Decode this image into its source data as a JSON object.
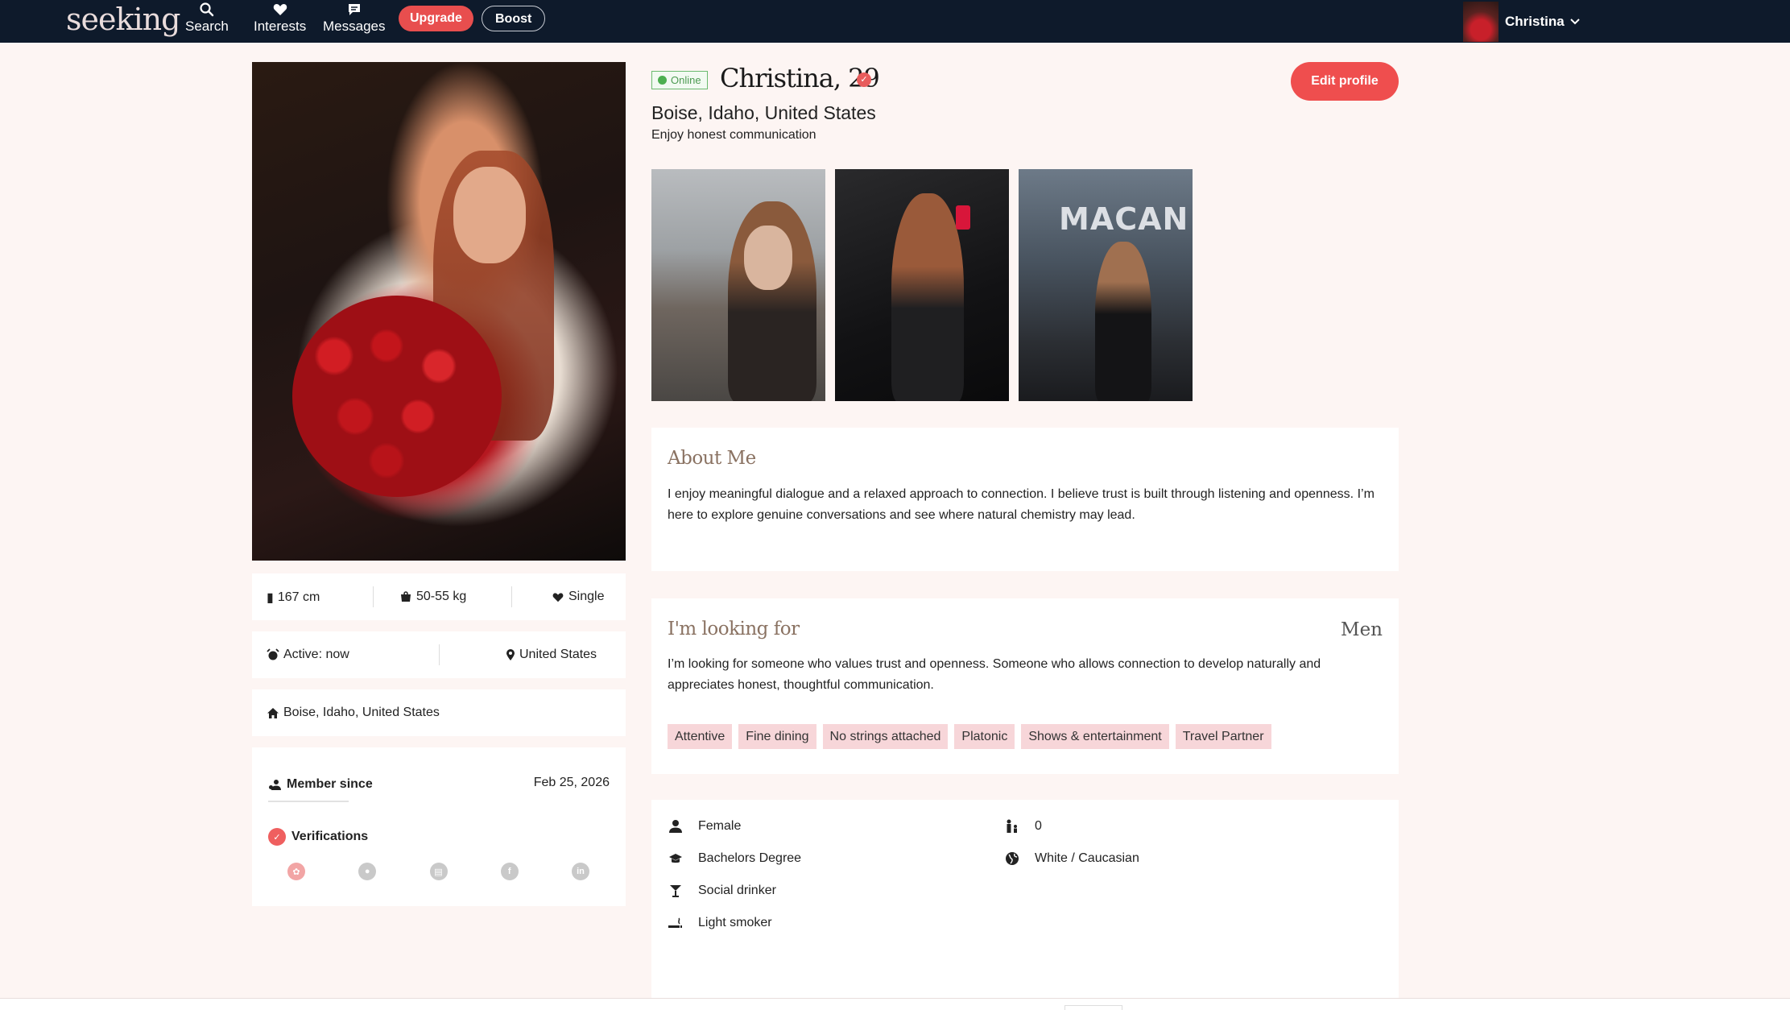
{
  "nav": {
    "logo": "seeking",
    "search": "Search",
    "interests": "Interests",
    "messages": "Messages",
    "upgrade": "Upgrade",
    "boost": "Boost",
    "user_name": "Christina"
  },
  "profile": {
    "online": "Online",
    "name": "Christina, 29",
    "location": "Boise, Idaho, United States",
    "tagline": "Enjoy honest communication",
    "edit_button": "Edit profile"
  },
  "stats": {
    "height": "167 cm",
    "weight": "50-55 kg",
    "status": "Single",
    "active": "Active: now",
    "country": "United States",
    "home": "Boise, Idaho, United States"
  },
  "member": {
    "label": "Member since",
    "date": "Feb 25, 2026",
    "verifications": "Verifications"
  },
  "thumbs": {
    "sign_text": "MACAN"
  },
  "about": {
    "title": "About Me",
    "text": "I enjoy meaningful dialogue and a relaxed approach to connection. I believe trust is built through listening and openness. I’m here to explore genuine conversations and see where natural chemistry may lead."
  },
  "looking": {
    "title": "I'm looking for",
    "target": "Men",
    "text": "I’m looking for someone who values trust and openness. Someone who allows connection to develop naturally and appreciates honest, thoughtful communication.",
    "tags": [
      "Attentive",
      "Fine dining",
      "No strings attached",
      "Platonic",
      "Shows & entertainment",
      "Travel Partner"
    ]
  },
  "details": {
    "gender": "Female",
    "education": "Bachelors Degree",
    "drinking": "Social drinker",
    "smoking": "Light smoker",
    "children": "0",
    "ethnicity": "White / Caucasian"
  },
  "colors": {
    "nav_bg": "#0e1a2b",
    "accent": "#ef4e4e",
    "page_bg": "#fdf5f3",
    "tag_bg": "#f7d6d9",
    "online_green": "#4caf50"
  }
}
